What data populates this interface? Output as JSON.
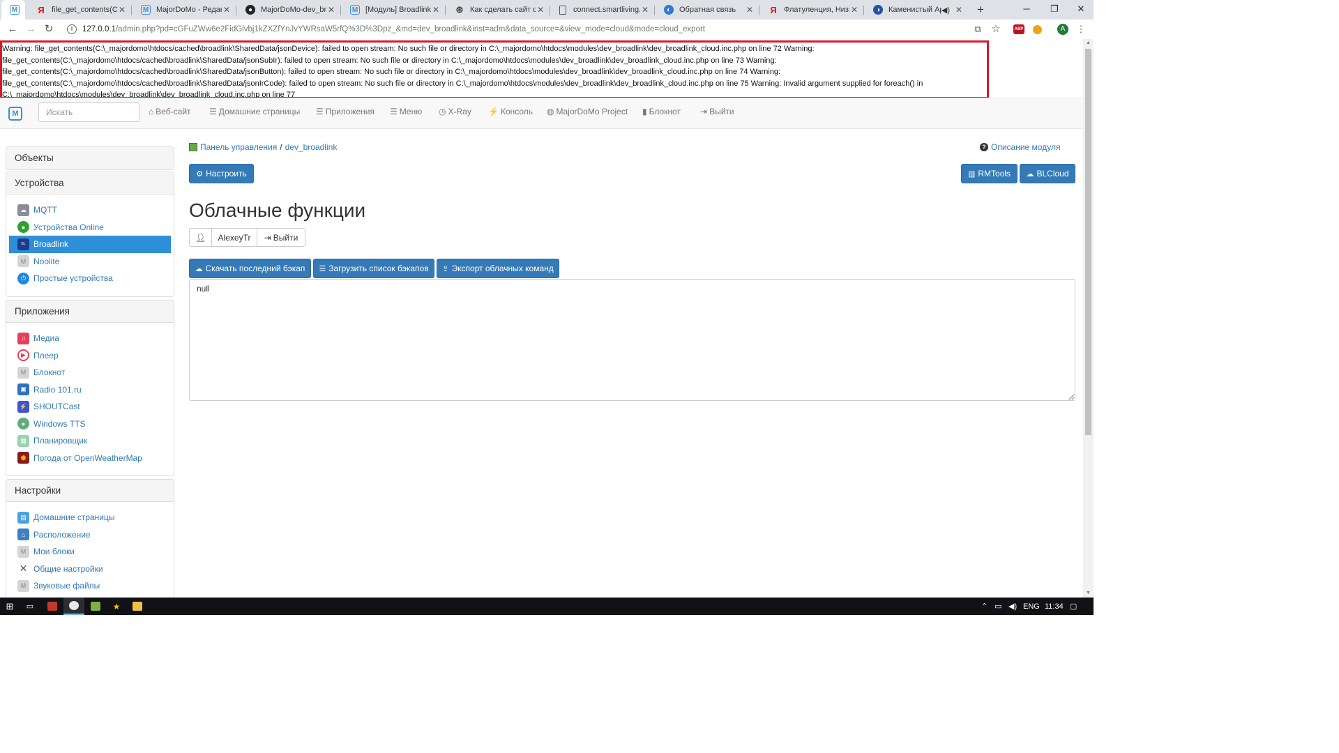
{
  "browser": {
    "tabs": [
      {
        "title": "",
        "favicon": "majordomo-icon",
        "active": true
      },
      {
        "title": "file_get_contents(C:\\_m",
        "favicon": "yandex-icon"
      },
      {
        "title": "MajorDoMo - Редакти",
        "favicon": "majordomo-icon"
      },
      {
        "title": "MajorDoMo-dev_broa",
        "favicon": "github-icon"
      },
      {
        "title": "[Модуль] Broadlink (d",
        "favicon": "majordomo-icon"
      },
      {
        "title": "Как сделать сайт сам",
        "favicon": "globe-icon"
      },
      {
        "title": "connect.smartliving.ru",
        "favicon": "page-icon"
      },
      {
        "title": "Обратная связь",
        "favicon": "globe-icon"
      },
      {
        "title": "Флатуленция, Низкая",
        "favicon": "yandex-icon"
      },
      {
        "title": "Каменистый Арт",
        "favicon": "globe-icon",
        "audio": true
      }
    ],
    "url_host": "127.0.0.1",
    "url_path": "/admin.php?pd=cGFuZWw6e2FidGlvbj1kZXZfYnJvYWRsaW5rfQ%3D%3Dpz_&md=dev_broadlink&inst=adm&data_source=&view_mode=cloud&mode=cloud_export",
    "profile_letter": "A",
    "abp_label": "ABP"
  },
  "warning": {
    "text": "Warning: file_get_contents(C:\\_majordomo\\htdocs/cached\\broadlink\\SharedData/jsonDevice): failed to open stream: No such file or directory in C:\\_majordomo\\htdocs\\modules\\dev_broadlink\\dev_broadlink_cloud.inc.php on line 72 Warning:\nfile_get_contents(C:\\_majordomo\\htdocs/cached\\broadlink\\SharedData/jsonSubIr): failed to open stream: No such file or directory in C:\\_majordomo\\htdocs\\modules\\dev_broadlink\\dev_broadlink_cloud.inc.php on line 73 Warning:\nfile_get_contents(C:\\_majordomo\\htdocs/cached\\broadlink\\SharedData/jsonButton): failed to open stream: No such file or directory in C:\\_majordomo\\htdocs\\modules\\dev_broadlink\\dev_broadlink_cloud.inc.php on line 74 Warning:\nfile_get_contents(C:\\_majordomo\\htdocs/cached\\broadlink\\SharedData/jsonIrCode): failed to open stream: No such file or directory in C:\\_majordomo\\htdocs\\modules\\dev_broadlink\\dev_broadlink_cloud.inc.php on line 75 Warning: Invalid argument supplied for foreach() in\nC:\\_majordomo\\htdocs\\modules\\dev_broadlink\\dev_broadlink_cloud.inc.php on line 77"
  },
  "navbar": {
    "search_placeholder": "Искать",
    "links": [
      "Веб-сайт",
      "Домашние страницы",
      "Приложения",
      "Меню",
      "X-Ray",
      "Консоль",
      "MajorDoMo Project",
      "Блокнот",
      "Выйти"
    ]
  },
  "sidebar": {
    "objects_title": "Объекты",
    "devices_title": "Устройства",
    "devices": [
      "MQTT",
      "Устройства Online",
      "Broadlink",
      "Noolite",
      "Простые устройства"
    ],
    "apps_title": "Приложения",
    "apps": [
      "Медиа",
      "Плеер",
      "Блокнот",
      "Radio 101.ru",
      "SHOUTCast",
      "Windows TTS",
      "Планировщик",
      "Погода от OpenWeatherMap"
    ],
    "settings_title": "Настройки",
    "settings": [
      "Домашние страницы",
      "Расположение",
      "Мои блоки",
      "Общие настройки",
      "Звуковые файлы"
    ]
  },
  "main": {
    "breadcrumb_home": "Панель управления",
    "breadcrumb_current": "dev_broadlink",
    "module_help": "Описание модуля",
    "configure_button": "Настроить",
    "rmtools_button": "RMTools",
    "blcloud_button": "BLCloud",
    "title": "Облачные функции",
    "username": "AlexeyTr",
    "logout_button": "Выйти",
    "download_backup_button": "Скачать последний бэкап",
    "load_backups_button": "Загрузить список бэкапов",
    "export_button": "Экспорт облачных команд",
    "output_value": "null"
  },
  "taskbar": {
    "language": "ENG",
    "time": "11:34"
  },
  "colors": {
    "warning_border": "#d7192c",
    "primary": "#337ab7",
    "active_item": "#2e8fd8"
  }
}
